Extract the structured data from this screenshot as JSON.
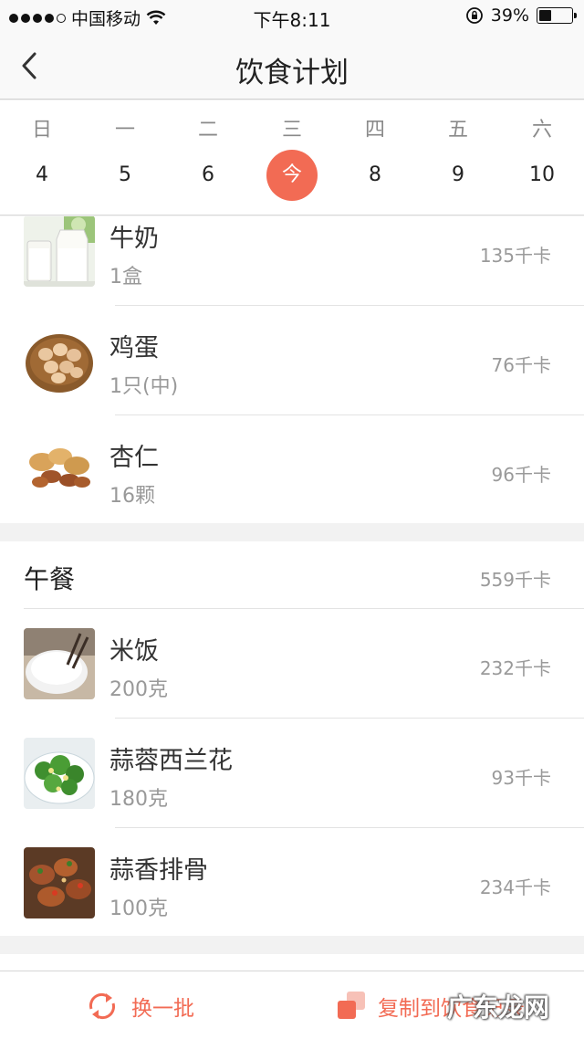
{
  "status_bar": {
    "carrier": "中国移动",
    "time": "下午8:11",
    "battery_percent": "39%",
    "battery_level": 0.39
  },
  "nav": {
    "title": "饮食计划",
    "back_icon": "chevron-left-icon"
  },
  "week": {
    "accent_color": "#f26b54",
    "days": [
      {
        "name": "日",
        "num": "4"
      },
      {
        "name": "一",
        "num": "5"
      },
      {
        "name": "二",
        "num": "6"
      },
      {
        "name": "三",
        "num": "今",
        "today": true
      },
      {
        "name": "四",
        "num": "8"
      },
      {
        "name": "五",
        "num": "9"
      },
      {
        "name": "六",
        "num": "10"
      }
    ]
  },
  "breakfast": {
    "items": [
      {
        "name": "牛奶",
        "amount": "1盒",
        "cal": "135千卡"
      },
      {
        "name": "鸡蛋",
        "amount": "1只(中)",
        "cal": "76千卡"
      },
      {
        "name": "杏仁",
        "amount": "16颗",
        "cal": "96千卡"
      }
    ]
  },
  "lunch": {
    "title": "午餐",
    "cal": "559千卡",
    "items": [
      {
        "name": "米饭",
        "amount": "200克",
        "cal": "232千卡"
      },
      {
        "name": "蒜蓉西兰花",
        "amount": "180克",
        "cal": "93千卡"
      },
      {
        "name": "蒜香排骨",
        "amount": "100克",
        "cal": "234千卡"
      }
    ]
  },
  "bottom_bar": {
    "refresh_label": "换一批",
    "copy_label": "复制到饮食记录"
  },
  "watermark": "广东龙网"
}
